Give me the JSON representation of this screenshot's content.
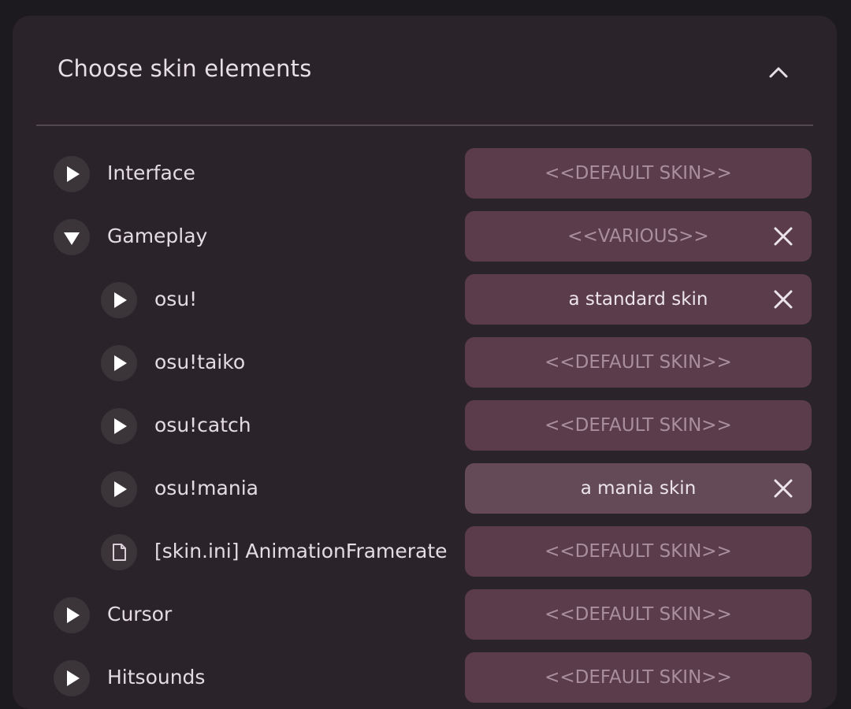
{
  "header": {
    "title": "Choose skin elements",
    "collapse_icon": "chevron-up-icon"
  },
  "rows": [
    {
      "label": "Interface",
      "toggle": "play-right-icon",
      "value": "<<DEFAULT SKIN>>",
      "clearable": false
    },
    {
      "label": "Gameplay",
      "toggle": "play-down-icon",
      "value": "<<VARIOUS>>",
      "clearable": true
    },
    {
      "label": "osu!",
      "toggle": "play-right-icon",
      "value": "a standard skin",
      "clearable": true
    },
    {
      "label": "osu!taiko",
      "toggle": "play-right-icon",
      "value": "<<DEFAULT SKIN>>",
      "clearable": false
    },
    {
      "label": "osu!catch",
      "toggle": "play-right-icon",
      "value": "<<DEFAULT SKIN>>",
      "clearable": false
    },
    {
      "label": "osu!mania",
      "toggle": "play-right-icon",
      "value": "a mania skin",
      "clearable": true
    },
    {
      "label": "[skin.ini] AnimationFramerate",
      "toggle": "file-icon",
      "value": "<<DEFAULT SKIN>>",
      "clearable": false
    },
    {
      "label": "Cursor",
      "toggle": "play-right-icon",
      "value": "<<DEFAULT SKIN>>",
      "clearable": false
    },
    {
      "label": "Hitsounds",
      "toggle": "play-right-icon",
      "value": "<<DEFAULT SKIN>>",
      "clearable": false
    }
  ],
  "colors": {
    "panel": "#2a2329",
    "selector": "#5a3c4a",
    "placeholder_text": "#a98e9d",
    "value_text": "#ece4ea"
  }
}
